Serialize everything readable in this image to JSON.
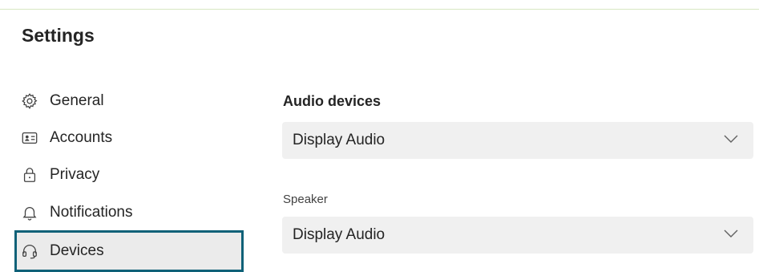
{
  "page": {
    "title": "Settings"
  },
  "sidebar": {
    "items": [
      {
        "label": "General",
        "icon": "gear-icon",
        "selected": false
      },
      {
        "label": "Accounts",
        "icon": "contact-card-icon",
        "selected": false
      },
      {
        "label": "Privacy",
        "icon": "lock-icon",
        "selected": false
      },
      {
        "label": "Notifications",
        "icon": "bell-icon",
        "selected": false
      },
      {
        "label": "Devices",
        "icon": "headset-icon",
        "selected": true
      }
    ]
  },
  "main": {
    "section_heading": "Audio devices",
    "audio_device": {
      "value": "Display Audio",
      "icon": "chevron-down-icon"
    },
    "speaker": {
      "label": "Speaker",
      "value": "Display Audio",
      "icon": "chevron-down-icon"
    }
  },
  "colors": {
    "selection_border": "#0f6178",
    "selection_background": "#ebebeb",
    "dropdown_background": "#f0f0f0",
    "top_rule": "#d7e7c2"
  }
}
